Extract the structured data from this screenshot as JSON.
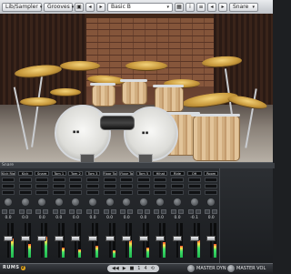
{
  "topbar": {
    "lib_sampler": "Lib/Sampler",
    "grooves": "Grooves",
    "preset": "Basic B",
    "snare": "Snare"
  },
  "mixer": {
    "section_label": "Snare",
    "channels": [
      {
        "label": "Kick Right",
        "volume": "0.0",
        "meter": 0.55,
        "fader": 0.55
      },
      {
        "label": "Kick",
        "volume": "0.0",
        "meter": 0.4,
        "fader": 0.55
      },
      {
        "label": "Snare",
        "volume": "0.0",
        "meter": 0.6,
        "fader": 0.55
      },
      {
        "label": "Tom 1",
        "volume": "0.0",
        "meter": 0.3,
        "fader": 0.55
      },
      {
        "label": "Tom 2",
        "volume": "0.0",
        "meter": 0.25,
        "fader": 0.55
      },
      {
        "label": "Tom 3",
        "volume": "0.0",
        "meter": 0.35,
        "fader": 0.55
      },
      {
        "label": "Floor Tom 1",
        "volume": "0.0",
        "meter": 0.2,
        "fader": 0.55
      },
      {
        "label": "Floor Tom 2",
        "volume": "0.0",
        "meter": 0.5,
        "fader": 0.55
      },
      {
        "label": "Tom 5",
        "volume": "0.0",
        "meter": 0.3,
        "fader": 0.55
      },
      {
        "label": "Hihat",
        "volume": "0.0",
        "meter": 0.45,
        "fader": 0.55
      },
      {
        "label": "Ride",
        "volume": "0.0",
        "meter": 0.35,
        "fader": 0.55
      },
      {
        "label": "OH",
        "volume": "-0.1",
        "meter": 0.5,
        "fader": 0.55
      },
      {
        "label": "Room",
        "volume": "0.0",
        "meter": 0.4,
        "fader": 0.55
      }
    ]
  },
  "bottom": {
    "brand": "RUMS",
    "brand_num": "2",
    "transport_position": "1",
    "transport_beat": "4",
    "master_dyn": "MASTER DYN",
    "master_vol": "MASTER VOL"
  }
}
